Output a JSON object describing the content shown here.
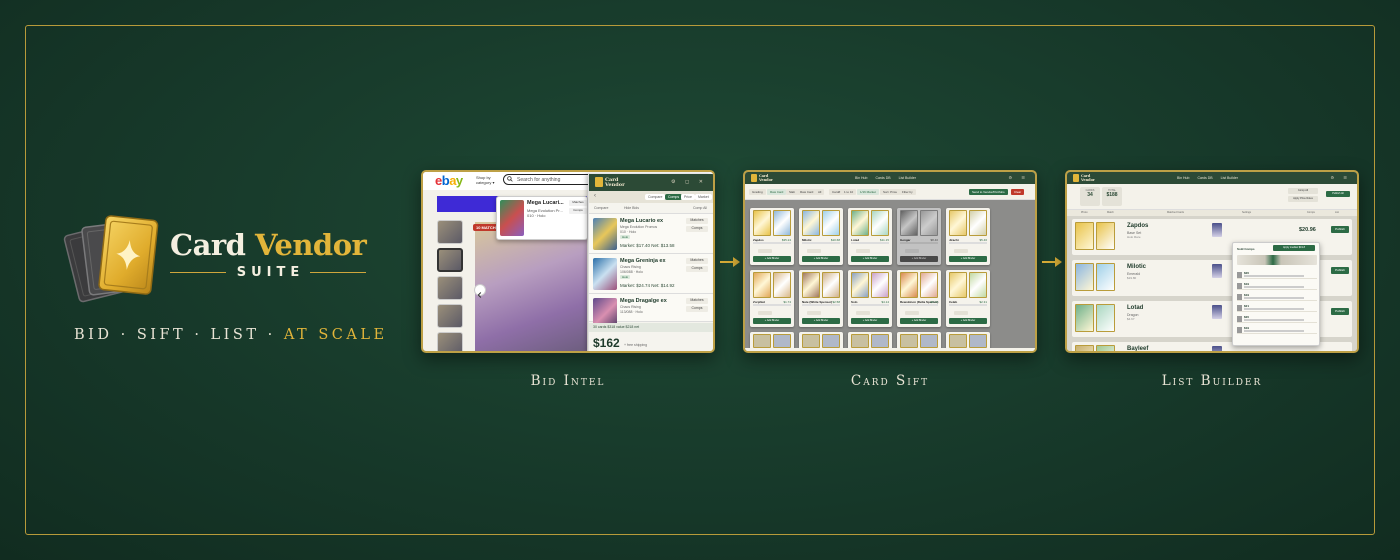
{
  "brand": {
    "word1": "Card",
    "word2": "Vendor",
    "sub": "SUITE",
    "colors": {
      "gold": "#e2b53a",
      "cream": "#f4efe0",
      "green_bg": "#17392a",
      "frame": "#b79a3a"
    }
  },
  "tagline": {
    "part1": "BID · SIFT · LIST ·",
    "part2": "AT SCALE"
  },
  "captions": [
    "Bid Intel",
    "Card Sift",
    "List Builder"
  ],
  "bid_intel": {
    "ebay_logo": [
      "e",
      "b",
      "a",
      "y"
    ],
    "shop_by": "Shop by",
    "shop_by_2": "category",
    "search_placeholder": "Search for anything",
    "matches_tag": "10 MATCHES",
    "popup": {
      "title": "Mega Lucari...",
      "sub": "Mega Evolution Pr...",
      "set": "010 · Holo",
      "btn1": "Matches",
      "btn2": "Comps"
    },
    "panel": {
      "app_name_1": "Card",
      "app_name_2": "Vendor",
      "nav": [
        "Compare",
        "Comps",
        "Price",
        "Market"
      ],
      "sub_left": "Compare",
      "sub_mid": "Hide Bids",
      "sub_right": "Comp All",
      "rows": [
        {
          "title": "Mega Lucario ex",
          "set": "Mega Evolution Promos",
          "num": "010 · Holo",
          "tag": "Holo",
          "price": "Market: $17.40   Net: $13.58",
          "btn1": "Matches",
          "btn2": "Comps"
        },
        {
          "title": "Mega Greninja ex",
          "set": "Chaos Rising",
          "num": "106/088 · Holo",
          "tag": "Holo",
          "price": "Market: $24.74   Net: $14.92",
          "btn1": "Matches",
          "btn2": "Comps"
        },
        {
          "title": "Mega Dragalge ex",
          "set": "Chaos Rising",
          "num": "113/088 · Holo",
          "tag": "",
          "price": "",
          "btn1": "Matches",
          "btn2": "Comps"
        }
      ],
      "stats": "30 cards   $318 value   $218 net",
      "total": "$162",
      "ship": "+ free shipping"
    }
  },
  "card_sift": {
    "nav": [
      "Bin Hub",
      "Cards DB",
      "List Builder"
    ],
    "filters": [
      "Grading",
      "Raw Card",
      "Slab",
      "Raw Card",
      "All",
      "Card#",
      "1 to 10",
      "1/16 Market",
      "Sort: Price",
      "Filter by"
    ],
    "action_green": "Send to Vendor/Portfolio",
    "action_red": "Clear",
    "tiles": [
      {
        "name": "Zapdos",
        "price": "$35.24"
      },
      {
        "name": "Milotic",
        "price": "$10.68"
      },
      {
        "name": "Lotad",
        "price": "$11.15"
      },
      {
        "name": "Gengar",
        "price": "$8.40"
      },
      {
        "name": "Jirachi",
        "price": "$5.46"
      },
      {
        "name": "Zorphlet",
        "price": "$1.74"
      },
      {
        "name": "Nate (White Spenser)",
        "price": "$2.58"
      },
      {
        "name": "Solo",
        "price": "$4.14"
      },
      {
        "name": "Rewokinon (Delta Species)",
        "price": "$3.15"
      },
      {
        "name": "Celeb",
        "price": "$2.31"
      }
    ],
    "add_label": "+ Add Binder"
  },
  "list_builder": {
    "stats": [
      {
        "label": "CARDS",
        "value": "34"
      },
      {
        "label": "TOTAL",
        "value": "$188"
      }
    ],
    "btn_publish": "Publish All",
    "btn_comp": "Comp All",
    "btn_apply": "Apply Price Rules",
    "tabs": [
      "Photo",
      "Match",
      "Matched Cards",
      "Settings",
      "Comps",
      "List"
    ],
    "rows": [
      {
        "name": "Zapdos",
        "set": "Base Set",
        "sub": "Holo Rare",
        "price": "$20.96",
        "go": "Publish"
      },
      {
        "name": "Milotic",
        "set": "Emerald",
        "sub": "$19.80",
        "price": "",
        "go": "Publish"
      },
      {
        "name": "Lotad",
        "set": "Dragon",
        "sub": "$4.67",
        "price": "",
        "go": "Publish"
      },
      {
        "name": "Bayleef",
        "set": "",
        "sub": "",
        "price": "",
        "go": ""
      }
    ],
    "popup": {
      "title": "Sold Comps",
      "apply": "Apply median $19.8",
      "items": [
        "$20",
        "$19",
        "$19",
        "$21",
        "$20",
        "$19"
      ]
    }
  }
}
